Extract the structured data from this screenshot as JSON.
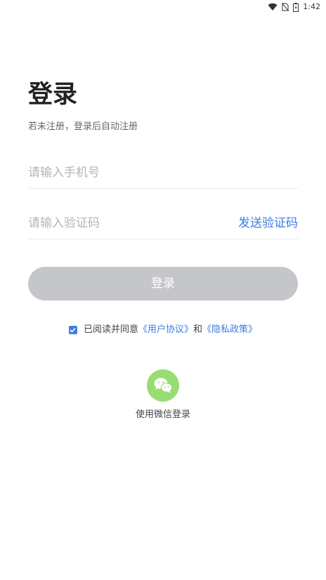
{
  "status_bar": {
    "time": "1:42",
    "icons": [
      "wifi-icon",
      "no-sim-icon",
      "battery-icon"
    ]
  },
  "login": {
    "title": "登录",
    "subtitle": "若未注册，登录后自动注册",
    "phone_placeholder": "请输入手机号",
    "phone_value": "",
    "code_placeholder": "请输入验证码",
    "code_value": "",
    "send_code_label": "发送验证码",
    "submit_label": "登录"
  },
  "agreement": {
    "checked": true,
    "prefix": "已阅读并同意",
    "user_agreement": "《用户协议》",
    "and": "和",
    "privacy_policy": "《隐私政策》"
  },
  "wechat_login": {
    "label": "使用微信登录",
    "icon": "wechat-icon"
  },
  "colors": {
    "accent": "#3d7ce0",
    "button_disabled": "#c4c6c9",
    "wechat_green": "#97dd73"
  }
}
